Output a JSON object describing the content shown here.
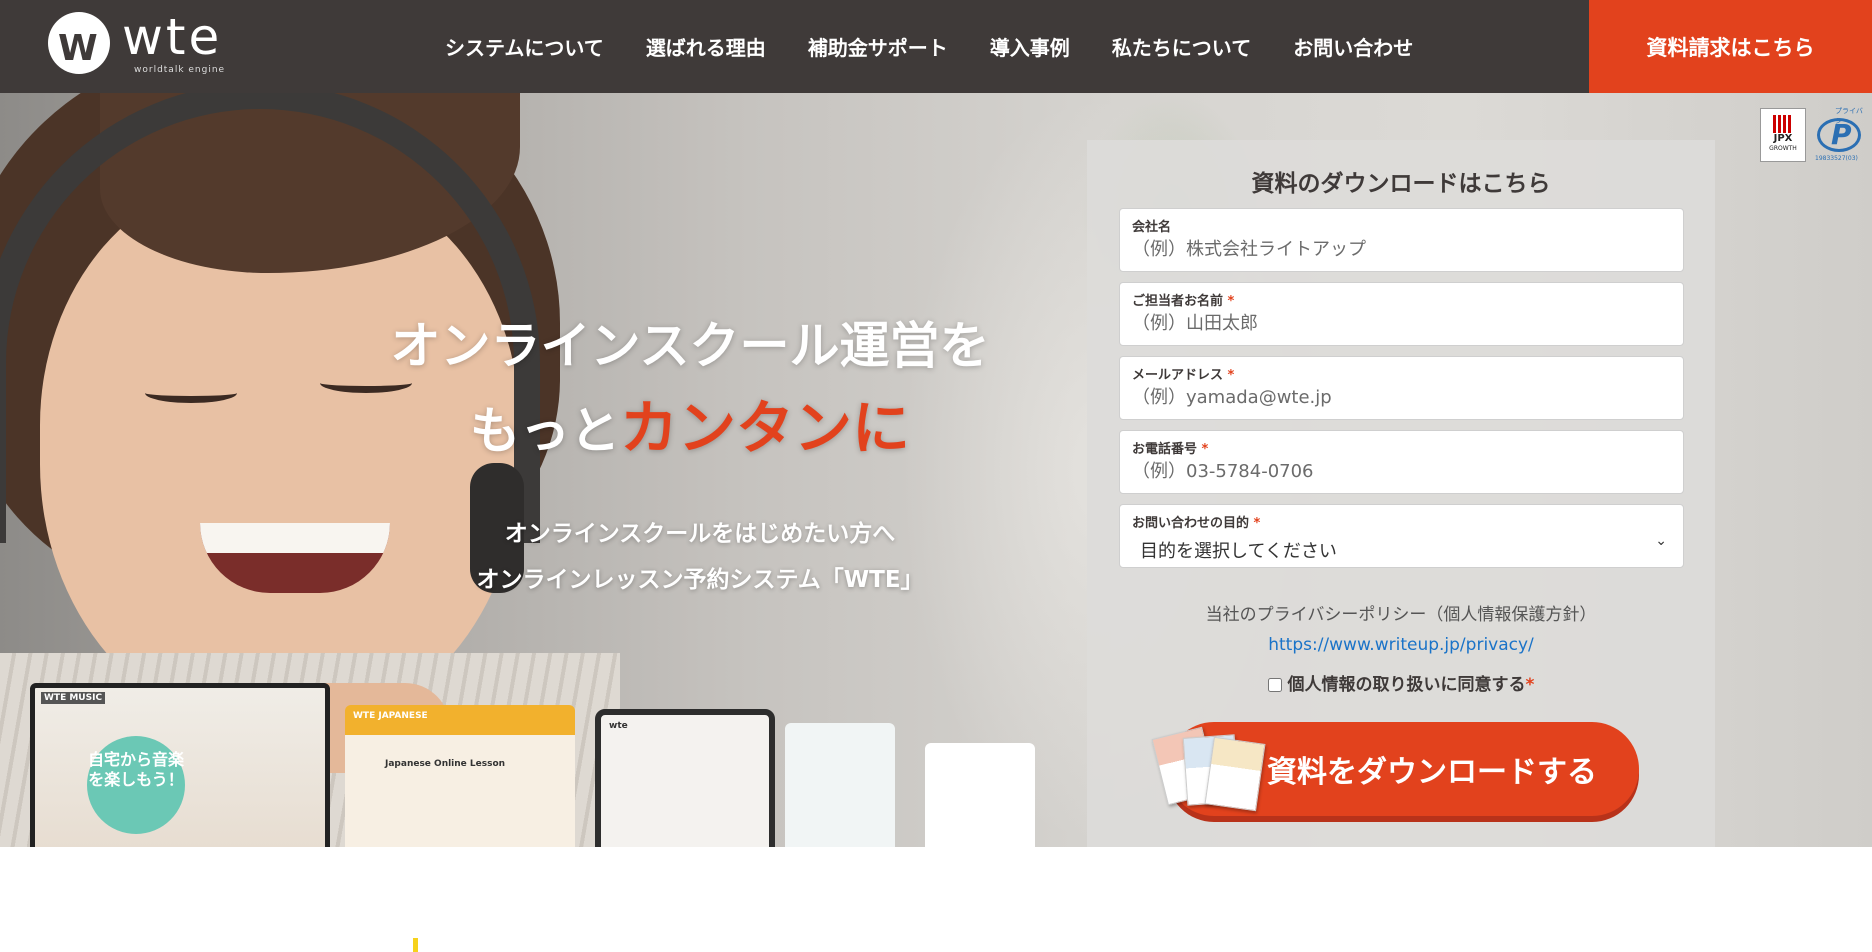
{
  "header": {
    "logo_text": "wte",
    "logo_mark": "W",
    "logo_sub": "worldtalk engine",
    "nav": [
      "システムについて",
      "選ばれる理由",
      "補助金サポート",
      "導入事例",
      "私たちについて",
      "お問い合わせ"
    ],
    "cta": "資料請求はこちら"
  },
  "hero": {
    "title_line1": "オンラインスクール運営を",
    "title_line2_prefix": "もっと",
    "title_line2_accent": "カンタンに",
    "subtitle_line1": "オンラインスクールをはじめたい方へ",
    "subtitle_line2": "オンラインレッスン予約システム「WTE」",
    "device1_brand": "WTE MUSIC",
    "device1_circle": "自宅から音楽を楽しもう！",
    "device2_title": "Japanese Online Lesson",
    "device2_brand": "WTE JAPANESE",
    "device3_brand": "wte"
  },
  "badges": {
    "jpx_label": "JPX",
    "jpx_sub": "GROWTH",
    "privacy_mark": "P",
    "privacy_arc": "プライバシー",
    "privacy_number": "19833527(03)"
  },
  "form": {
    "title": "資料のダウンロードはこちら",
    "fields": [
      {
        "label": "会社名",
        "required": false,
        "placeholder": "（例）株式会社ライトアップ"
      },
      {
        "label": "ご担当者お名前",
        "required": true,
        "placeholder": "（例）山田太郎"
      },
      {
        "label": "メールアドレス",
        "required": true,
        "placeholder": "（例）yamada@wte.jp"
      },
      {
        "label": "お電話番号",
        "required": true,
        "placeholder": "（例）03-5784-0706"
      }
    ],
    "purpose": {
      "label": "お問い合わせの目的",
      "required": true,
      "selected": "目的を選択してください"
    },
    "required_mark": "*",
    "privacy_text": "当社のプライバシーポリシー（個人情報保護方針）",
    "privacy_url": "https://www.writeup.jp/privacy/",
    "agree_label": "個人情報の取り扱いに同意する",
    "submit_label": "資料をダウンロードする"
  },
  "colors": {
    "header_bg": "#3f3a39",
    "accent": "#e2421d",
    "link": "#1a73c8"
  }
}
